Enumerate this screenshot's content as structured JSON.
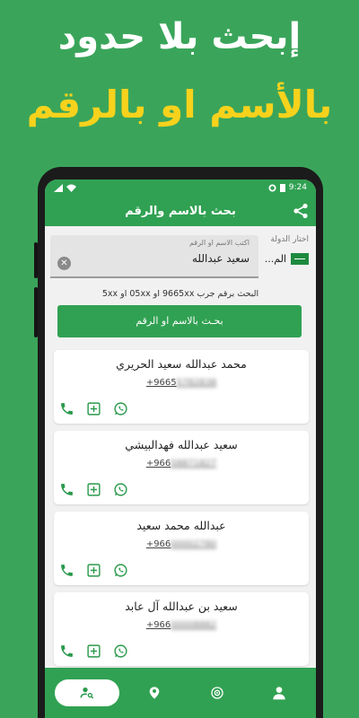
{
  "promo": {
    "line1": "إبحث بلا حدود",
    "line2": "بالأسم او بالرقم"
  },
  "status_bar": {
    "time": "9:24",
    "icons": [
      "signal-icon",
      "wifi-icon",
      "battery-icon",
      "gear-icon"
    ]
  },
  "app_bar": {
    "title": "بحث بالاسم والرقم",
    "action_icon": "share-icon"
  },
  "search": {
    "placeholder": "اكتب الاسم او الرقم",
    "value": "سعيد عبدالله"
  },
  "country": {
    "label": "اختار الدولة",
    "selected": "الم..."
  },
  "hint": "البحث برقم جرب 9665xx او 05xx او 5xx",
  "search_button_label": "بحـث بالاسم او الرقم",
  "results": [
    {
      "name": "محمد عبدالله سعيد الحريري",
      "number_prefix": "+9665",
      "number_masked": "5782838"
    },
    {
      "name": "سعيد عبدالله فهدالبيشي",
      "number_prefix": "+966",
      "number_masked": "58871827"
    },
    {
      "name": "عبدالله محمد سعيد",
      "number_prefix": "+966",
      "number_masked": "00002780"
    },
    {
      "name": "سعيد بن عبدالله آل عابد",
      "number_prefix": "+966",
      "number_masked": "00008882"
    }
  ],
  "bottom_nav": [
    {
      "icon": "person-search-icon",
      "active": true
    },
    {
      "icon": "location-pin-icon",
      "active": false
    },
    {
      "icon": "target-icon",
      "active": false
    },
    {
      "icon": "person-icon",
      "active": false
    }
  ],
  "colors": {
    "background": "#3aa55a",
    "primary": "#30a152",
    "accent_yellow": "#f7d21c"
  }
}
